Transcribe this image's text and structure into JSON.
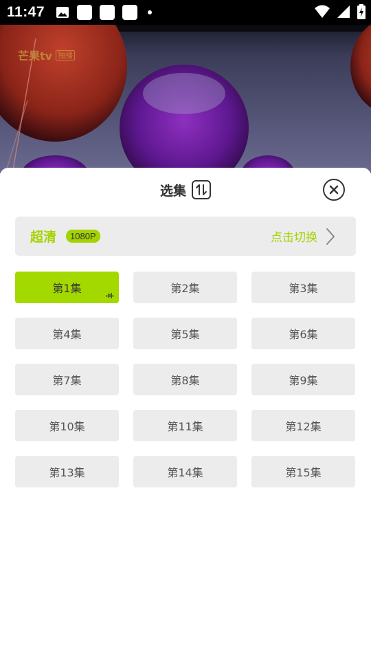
{
  "status_bar": {
    "time": "11:47"
  },
  "video": {
    "watermark_brand": "芒果tv",
    "watermark_badge": "独播"
  },
  "sheet": {
    "title": "选集"
  },
  "quality": {
    "name": "超清",
    "badge": "1080P",
    "switch_label": "点击切换"
  },
  "episodes": [
    {
      "label": "第1集",
      "active": true
    },
    {
      "label": "第2集"
    },
    {
      "label": "第3集"
    },
    {
      "label": "第4集"
    },
    {
      "label": "第5集"
    },
    {
      "label": "第6集"
    },
    {
      "label": "第7集"
    },
    {
      "label": "第8集"
    },
    {
      "label": "第9集"
    },
    {
      "label": "第10集"
    },
    {
      "label": "第11集"
    },
    {
      "label": "第12集"
    },
    {
      "label": "第13集"
    },
    {
      "label": "第14集"
    },
    {
      "label": "第15集"
    }
  ],
  "colors": {
    "accent": "#a4d900",
    "button_bg": "#ececec",
    "text": "#555555"
  }
}
